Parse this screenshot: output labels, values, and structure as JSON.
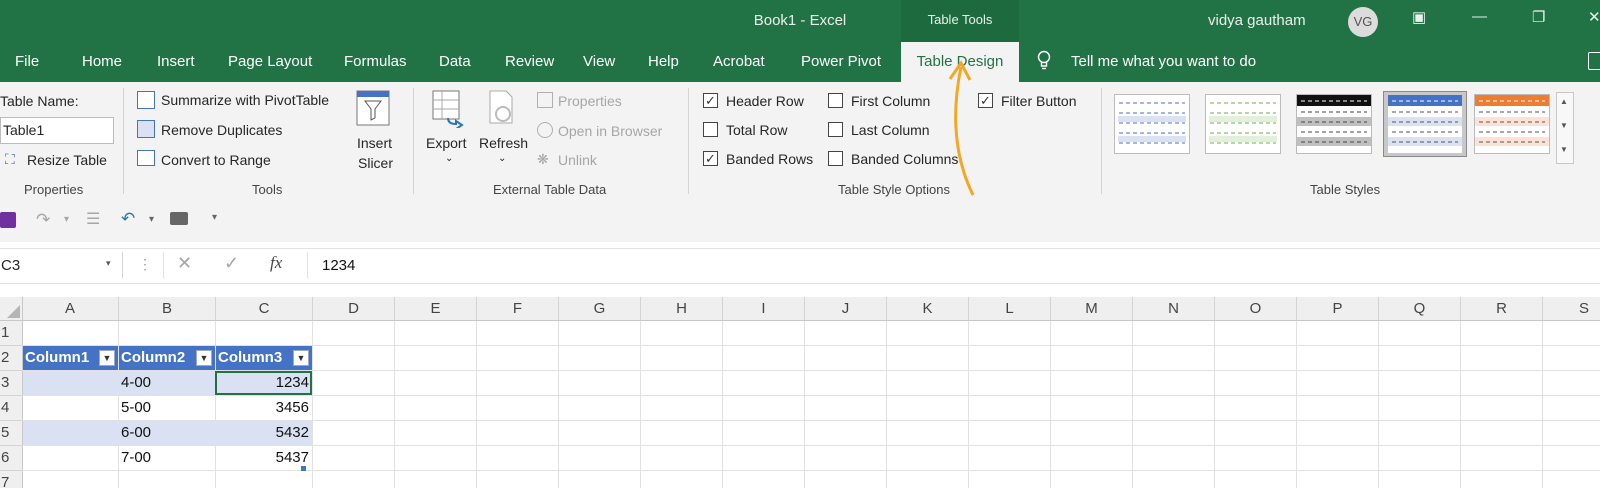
{
  "window": {
    "title": "Book1  -  Excel",
    "context_tab_group": "Table Tools",
    "user_name": "vidya gautham",
    "user_initials": "VG",
    "accent": "#217346",
    "table_accent": "#4472c4"
  },
  "tabs": [
    "File",
    "Home",
    "Insert",
    "Page Layout",
    "Formulas",
    "Data",
    "Review",
    "View",
    "Help",
    "Acrobat",
    "Power Pivot",
    "Table Design"
  ],
  "tell_me": "Tell me what you want to do",
  "ribbon": {
    "properties": {
      "table_name_label": "Table Name:",
      "table_name_value": "Table1",
      "resize_label": "Resize Table",
      "group_label": "Properties"
    },
    "tools": {
      "summarize": "Summarize with PivotTable",
      "remove_duplicates": "Remove Duplicates",
      "convert": "Convert to Range",
      "insert_slicer_line1": "Insert",
      "insert_slicer_line2": "Slicer",
      "group_label": "Tools"
    },
    "external": {
      "export": "Export",
      "refresh": "Refresh",
      "properties": "Properties",
      "open_browser": "Open in Browser",
      "unlink": "Unlink",
      "group_label": "External Table Data"
    },
    "style_options": {
      "header_row": "Header Row",
      "total_row": "Total Row",
      "banded_rows": "Banded Rows",
      "first_column": "First Column",
      "last_column": "Last Column",
      "banded_columns": "Banded Columns",
      "filter_button": "Filter Button",
      "group_label": "Table Style Options"
    },
    "table_styles": {
      "group_label": "Table Styles"
    }
  },
  "formula_bar": {
    "name_box": "C3",
    "fx": "fx",
    "value": "1234"
  },
  "columns": [
    "A",
    "B",
    "C",
    "D",
    "E",
    "F",
    "G",
    "H",
    "I",
    "J",
    "K",
    "L",
    "M",
    "N",
    "O",
    "P",
    "Q",
    "R",
    "S"
  ],
  "rows": [
    "1",
    "2",
    "3",
    "4",
    "5",
    "6",
    "7"
  ],
  "table": {
    "headers": [
      "Column1",
      "Column2",
      "Column3"
    ],
    "data": [
      [
        "",
        "4-00",
        "1234"
      ],
      [
        "",
        "5-00",
        "3456"
      ],
      [
        "",
        "6-00",
        "5432"
      ],
      [
        "",
        "7-00",
        "5437"
      ]
    ]
  }
}
